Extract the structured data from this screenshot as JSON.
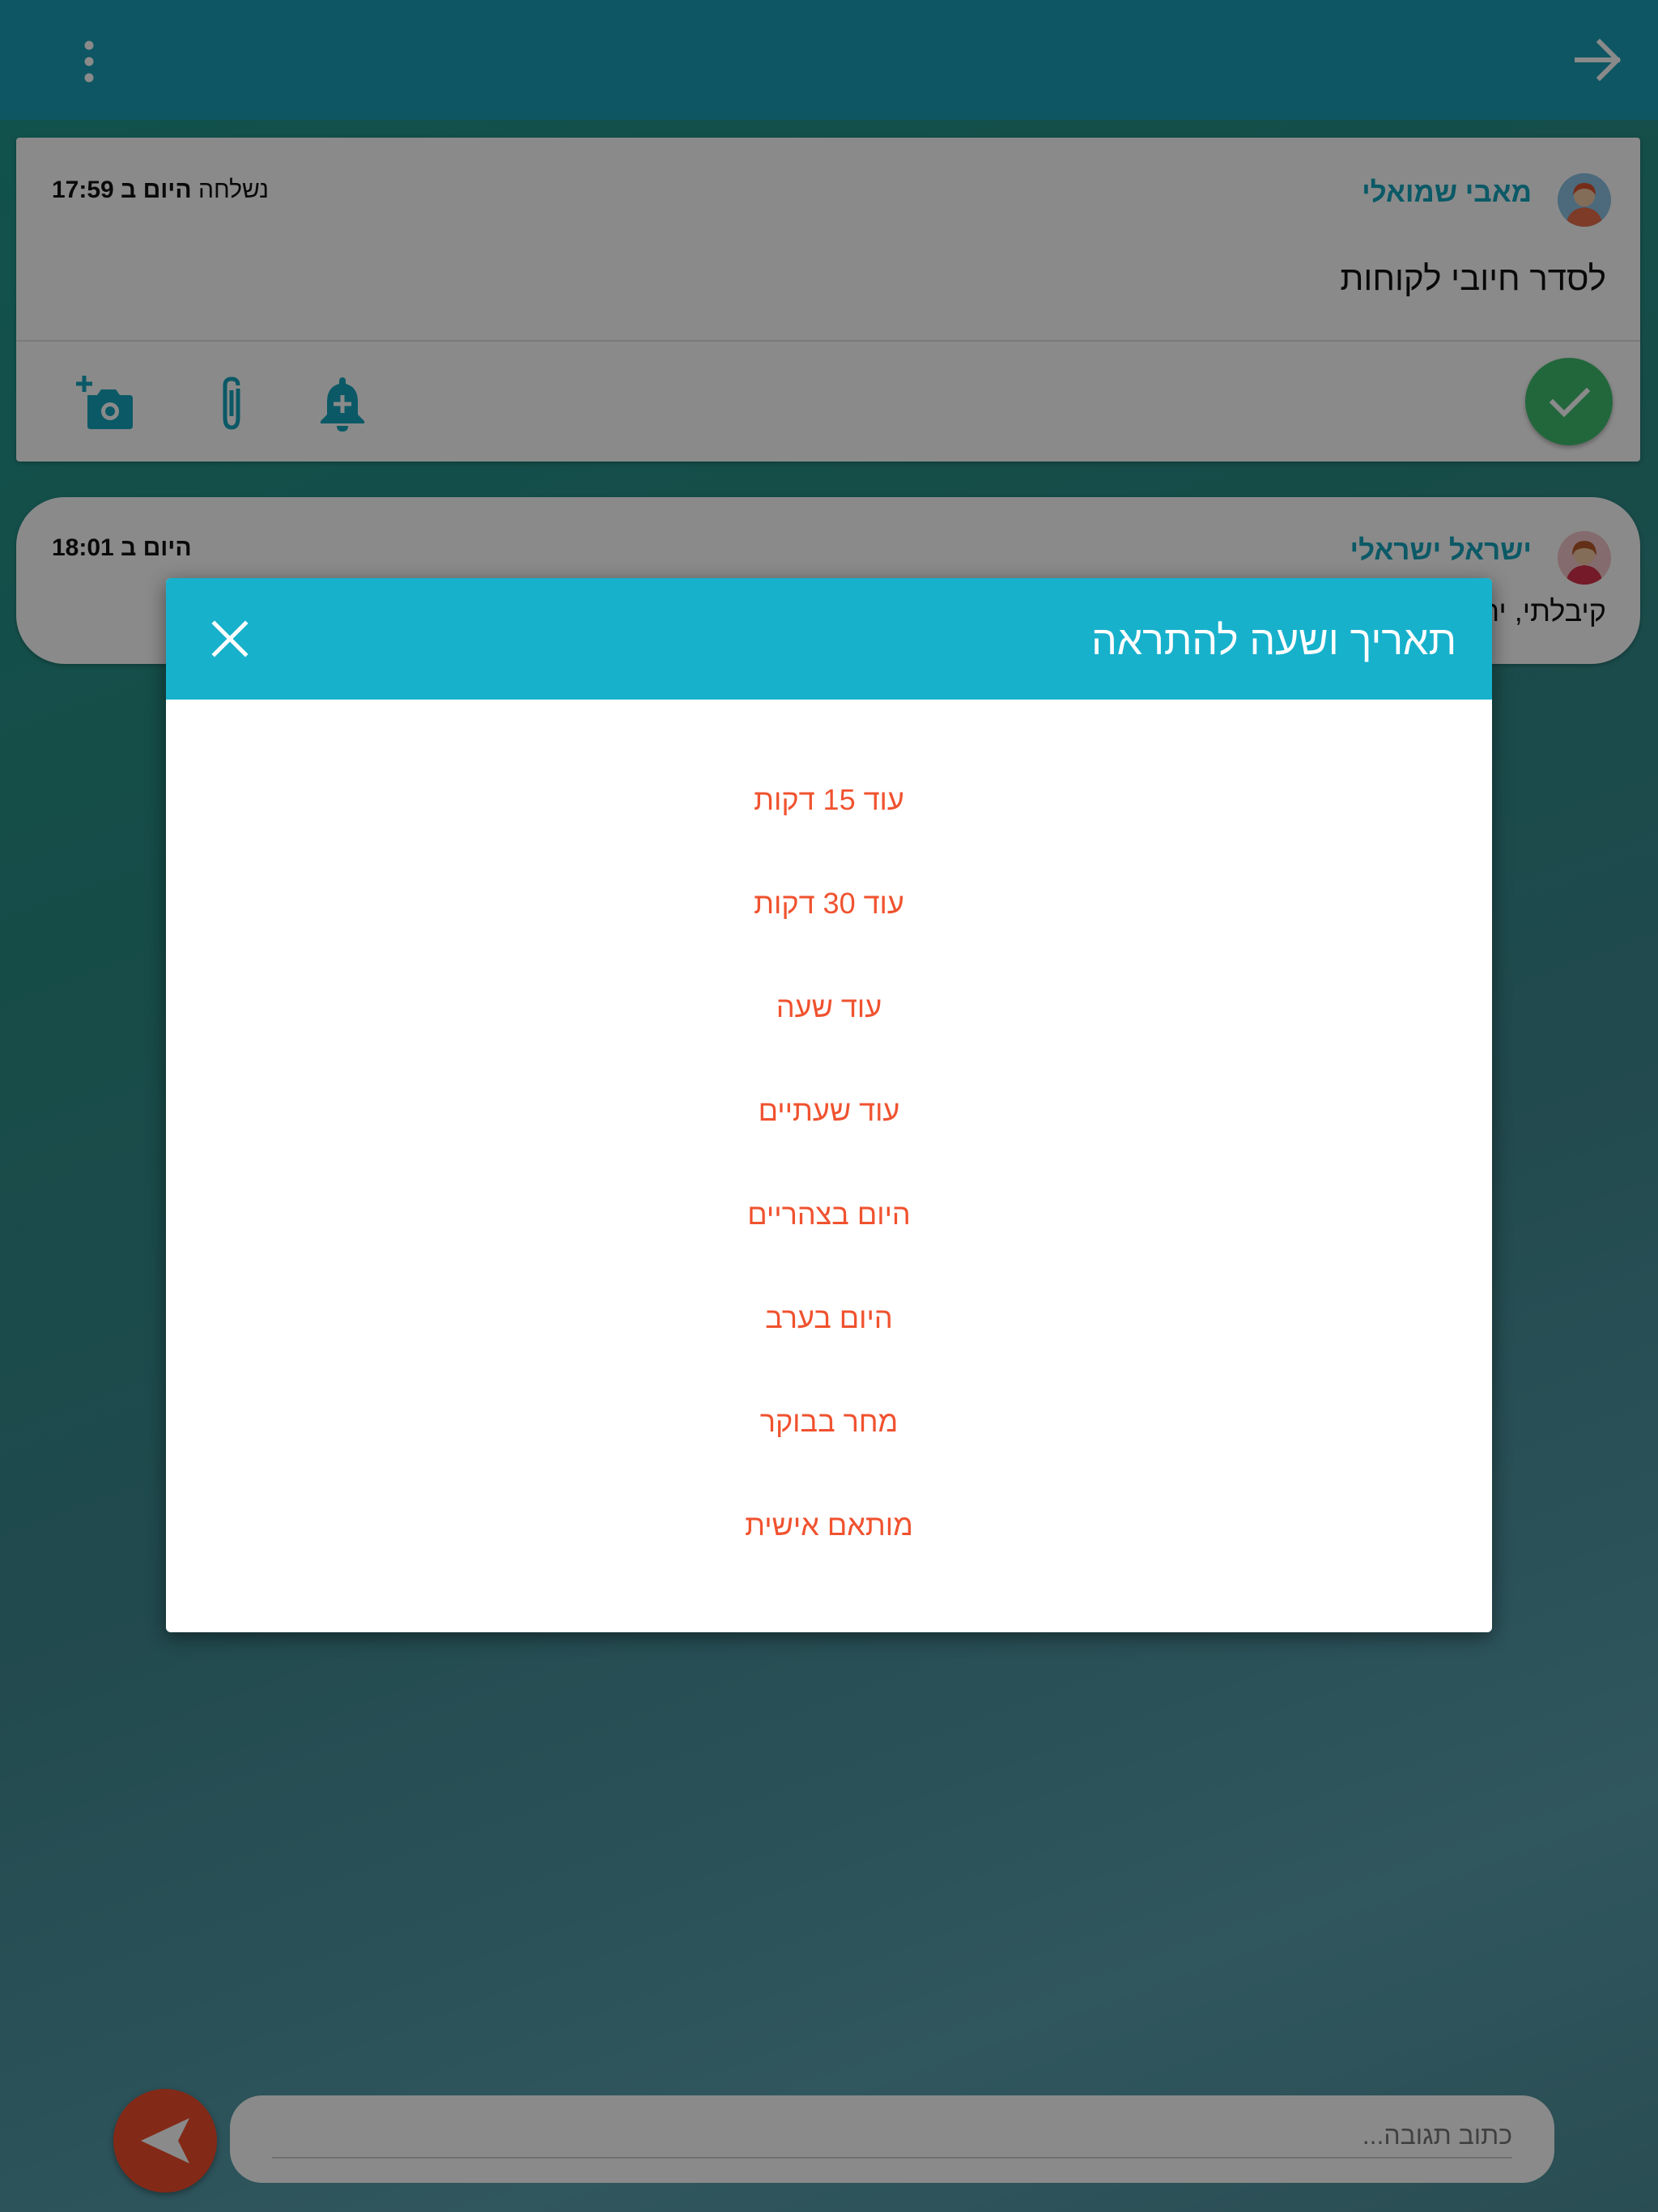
{
  "colors": {
    "primary": "#17b1cc",
    "accent": "#f0522f",
    "confirm": "#3fbf6f",
    "sender_name": "#16a4bd"
  },
  "topbar": {
    "back_icon": "arrow-right-icon",
    "menu_icon": "more-vertical-icon"
  },
  "message1": {
    "sender": "מאבי שמואלי",
    "status": "נשלחה",
    "time_prefix": "היום ב",
    "time": "17:59",
    "text": "לסדר חיובי לקוחות",
    "actions": {
      "camera_icon": "add-photo-icon",
      "attach_icon": "paperclip-icon",
      "reminder_icon": "bell-plus-icon",
      "done_icon": "check-icon"
    }
  },
  "message2": {
    "sender": "ישראל ישראלי",
    "time_prefix": "היום ב",
    "time": "18:01",
    "text": "קיבלתי, ית"
  },
  "reply": {
    "placeholder": "כתוב תגובה...",
    "send_icon": "send-icon"
  },
  "modal": {
    "title": "תאריך ושעה להתראה",
    "close_icon": "close-icon",
    "options": [
      "עוד 15 דקות",
      "עוד 30 דקות",
      "עוד שעה",
      "עוד שעתיים",
      "היום בצהריים",
      "היום בערב",
      "מחר בבוקר",
      "מותאם אישית"
    ]
  }
}
